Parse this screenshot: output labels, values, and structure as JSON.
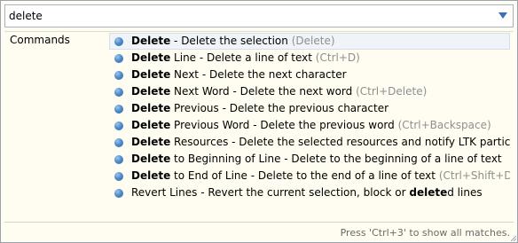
{
  "search": {
    "value": "delete",
    "dropdown_icon": "triangle-down-icon"
  },
  "results": {
    "category": "Commands",
    "items": [
      {
        "keyword": "Delete",
        "rest": " - Delete the selection",
        "shortcut": "(Delete)"
      },
      {
        "keyword": "Delete",
        "rest": " Line - Delete a line of text",
        "shortcut": "(Ctrl+D)"
      },
      {
        "keyword": "Delete",
        "rest": " Next - Delete the next character",
        "shortcut": ""
      },
      {
        "keyword": "Delete",
        "rest": " Next Word - Delete the next word",
        "shortcut": "(Ctrl+Delete)"
      },
      {
        "keyword": "Delete",
        "rest": " Previous - Delete the previous character",
        "shortcut": ""
      },
      {
        "keyword": "Delete",
        "rest": " Previous Word - Delete the previous word",
        "shortcut": "(Ctrl+Backspace)"
      },
      {
        "keyword": "Delete",
        "rest": " Resources - Delete the selected resources and notify LTK participants.",
        "shortcut": ""
      },
      {
        "keyword": "Delete",
        "rest": " to Beginning of Line - Delete to the beginning of a line of text",
        "shortcut": ""
      },
      {
        "keyword": "Delete",
        "rest": " to End of Line - Delete to the end of a line of text",
        "shortcut": "(Ctrl+Shift+Delete)"
      }
    ],
    "last_item": {
      "before": "Revert Lines - Revert the current selection, block or ",
      "keyword": "delete",
      "after": "d lines"
    },
    "bullet_icon": "command-bullet-icon"
  },
  "footer": {
    "hint": "Press 'Ctrl+3' to show all matches."
  }
}
